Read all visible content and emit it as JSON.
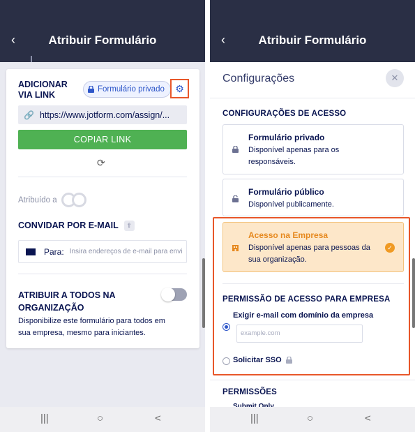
{
  "left": {
    "title": "Atribuir Formulário",
    "add_via_link": "ADICIONAR VIA LINK",
    "private_badge": "Formulário privado",
    "link_url": "https://www.jotform.com/assign/...",
    "copy_button": "COPIAR LINK",
    "assigned_to": "Atribuído a",
    "invite_email": "CONVIDAR POR E-MAIL",
    "to_label": "Para:",
    "email_placeholder": "Insira endereços de e-mail para envi",
    "assign_all_title": "ATRIBUIR A TODOS NA ORGANIZAÇÃO",
    "assign_all_desc": "Disponibilize este formulário para todos em sua empresa, mesmo para iniciantes.",
    "assign_all_enabled": false
  },
  "right": {
    "title": "Atribuir Formulário",
    "settings_title": "Configurações",
    "access_section": "CONFIGURAÇÕES DE ACESSO",
    "options": [
      {
        "title": "Formulário privado",
        "desc": "Disponível apenas para os responsáveis.",
        "selected": false
      },
      {
        "title": "Formulário público",
        "desc": "Disponível publicamente.",
        "selected": false
      },
      {
        "title": "Acesso na Empresa",
        "desc": "Disponível apenas para pessoas da sua organização.",
        "selected": true
      }
    ],
    "company_permission_section": "PERMISSÃO DE ACESSO PARA EMPRESA",
    "radio_domain": "Exigir e-mail com domínio da empresa",
    "domain_placeholder": "example.com",
    "radio_sso": "Solicitar SSO",
    "permissions_section": "PERMISSÕES",
    "submit_only": "Submit Only"
  },
  "navbar": {
    "recent": "|||",
    "home": "○",
    "back": "<"
  },
  "icons": {
    "back": "chevron-left-icon",
    "gear": "gear-icon",
    "lock": "lock-icon",
    "link": "link-icon",
    "refresh": "refresh-icon",
    "share": "share-icon",
    "envelope": "envelope-icon",
    "close": "close-icon",
    "building": "building-icon",
    "check": "check-icon"
  },
  "colors": {
    "appbar": "#2a2f45",
    "accent_blue": "#2d56c9",
    "copy_green": "#4fb153",
    "highlight": "#e8572a",
    "company_selected": "#fde7c9",
    "company_text": "#e6891f"
  }
}
